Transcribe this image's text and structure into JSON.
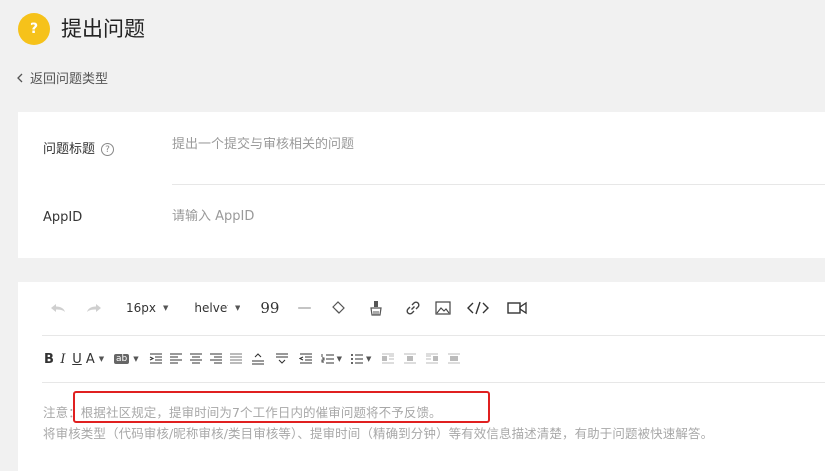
{
  "header": {
    "icon_char": "?",
    "title": "提出问题"
  },
  "back_link": {
    "label": "返回问题类型"
  },
  "form": {
    "question_title": {
      "label": "问题标题",
      "help_char": "?",
      "placeholder": "提出一个提交与审核相关的问题"
    },
    "appid": {
      "label": "AppID",
      "placeholder": "请输入 AppID"
    }
  },
  "editor": {
    "font_size": "16px",
    "font_family": "helvet",
    "quote_glyph": "99",
    "hr_glyph": "—",
    "bold": "B",
    "italic": "I",
    "underline": "U",
    "font_color": "A",
    "bg_color": "ab",
    "notice_line1": "注意：根据社区规定，提审时间为7个工作日内的催审问题将不予反馈。",
    "notice_line2": "将审核类型（代码审核/昵称审核/类目审核等）、提审时间（精确到分钟）等有效信息描述清楚，有助于问题被快速解答。"
  },
  "colors": {
    "accent": "#f6c21a",
    "highlight_box": "#e02020",
    "background": "#f1f1f1"
  }
}
